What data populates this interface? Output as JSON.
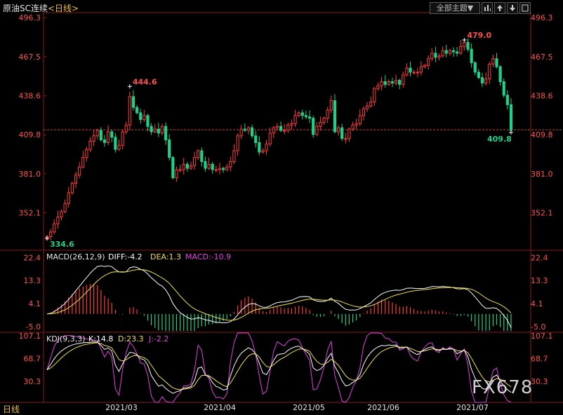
{
  "header": {
    "title": "原油SC连续",
    "timeframe": "<日线>",
    "theme_button": "全部主题",
    "theme_arrow": "▼",
    "theme_color": "#e6e6e6",
    "accent": "#e8c23a"
  },
  "footer": {
    "tab_label": "日线",
    "watermark": "FX678"
  },
  "chart_data": [
    {
      "type": "candlestick",
      "title": "原油SC连续",
      "y_ticks": [
        "496.3",
        "467.5",
        "438.6",
        "409.8",
        "381.0",
        "352.1"
      ],
      "ylim": [
        325,
        500
      ],
      "x_ticks": [
        "2021/03",
        "2021/04",
        "2021/05",
        "2021/06",
        "2021/07"
      ],
      "annotations": {
        "high": "444.6",
        "low": "334.6",
        "high2": "479.0",
        "last": "409.8"
      },
      "reference_line": 413.5,
      "up_color": "#ff3b3b",
      "down_color": "#1fd08a",
      "closes": [
        334.6,
        338,
        344,
        349,
        353,
        359,
        367,
        374,
        380,
        386,
        393,
        399,
        405,
        409,
        413,
        406,
        404,
        412,
        408,
        399,
        402,
        412,
        417,
        438,
        430,
        426,
        421,
        424,
        416,
        412,
        414,
        411,
        416,
        406,
        393,
        378,
        384,
        384,
        388,
        385,
        387,
        393,
        398,
        390,
        385,
        388,
        384,
        384,
        385,
        384,
        386,
        390,
        398,
        409,
        414,
        413,
        415,
        409,
        404,
        397,
        398,
        403,
        411,
        415,
        416,
        413,
        413,
        417,
        418,
        424,
        426,
        424,
        423,
        422,
        410,
        416,
        419,
        422,
        428,
        435,
        412,
        415,
        407,
        407,
        414,
        417,
        418,
        424,
        429,
        431,
        434,
        444,
        446,
        449,
        447,
        449,
        448,
        450,
        447,
        454,
        459,
        456,
        456,
        456,
        460,
        461,
        466,
        470,
        467,
        468,
        472,
        470,
        472,
        471,
        470,
        475,
        478,
        473,
        463,
        456,
        452,
        448,
        451,
        462,
        466,
        460,
        449,
        439,
        432,
        413
      ]
    },
    {
      "type": "line",
      "title": "MACD(26,12,9)",
      "labels": {
        "diff": "DIFF:-4.2",
        "dea": "DEA:1.3",
        "macd": "MACD:-10.9"
      },
      "y_ticks": [
        "22.4",
        "13.3",
        "4.1",
        "-5.0"
      ],
      "ylim": [
        -7,
        25
      ],
      "series_colors": {
        "diff": "#ffffff",
        "dea": "#f0e040",
        "macd": "#e040e0"
      }
    },
    {
      "type": "line",
      "title": "KDJ(9,3,3)",
      "labels": {
        "k": "K:14.8",
        "d": "D:23.3",
        "j": "J:-2.2"
      },
      "y_ticks": [
        "107.1",
        "68.7",
        "30.3"
      ],
      "ylim": [
        -5,
        112
      ],
      "series_colors": {
        "k": "#ffffff",
        "d": "#f0e040",
        "j": "#e040e0"
      }
    }
  ]
}
